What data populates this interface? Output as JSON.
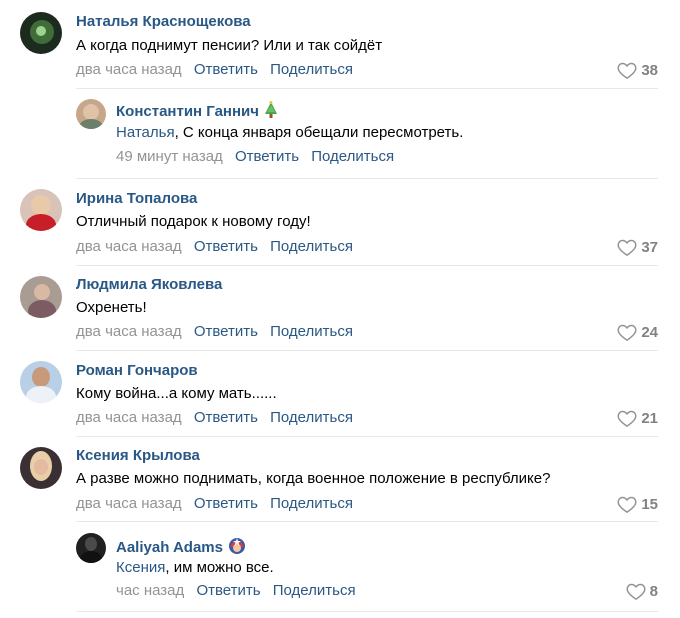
{
  "actions": {
    "reply": "Ответить",
    "share": "Поделиться"
  },
  "comments": [
    {
      "author": "Наталья Краснощекова",
      "text": "А когда поднимут пенсии? Или и так сойдёт",
      "time": "два часа назад",
      "likes": "38"
    },
    {
      "author": "Константин Ганнич",
      "mention": "Наталья",
      "text": ", С конца января обещали пересмотреть.",
      "time": "49 минут назад",
      "likes": ""
    },
    {
      "author": "Ирина Топалова",
      "text": "Отличный подарок к новому году!",
      "time": "два часа назад",
      "likes": "37"
    },
    {
      "author": "Людмила Яковлева",
      "text": "Охренеть!",
      "time": "два часа назад",
      "likes": "24"
    },
    {
      "author": "Роман Гончаров",
      "text": "Кому война...а кому мать......",
      "time": "два часа назад",
      "likes": "21"
    },
    {
      "author": "Ксения Крылова",
      "text": "А разве можно поднимать, когда военное положение в республике?",
      "time": "два часа назад",
      "likes": "15"
    },
    {
      "author": "Aaliyah Adams",
      "mention": "Ксения",
      "text": ", им можно все.",
      "time": "час назад",
      "likes": "8"
    }
  ]
}
